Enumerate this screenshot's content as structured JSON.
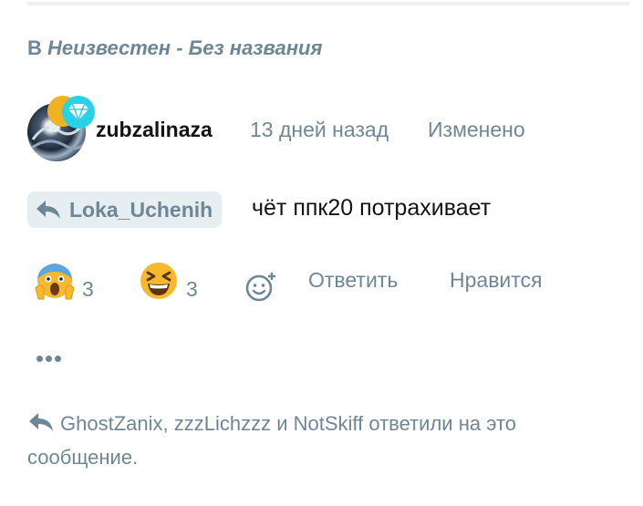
{
  "context": {
    "prefix": "В",
    "thread": "Неизвестен - Без названия"
  },
  "post": {
    "username": "zubzalinaza",
    "time": "13 дней назад",
    "edited": "Изменено",
    "reply_to": "Loka_Uchenih",
    "text": "чёт ппк20 потрахивает"
  },
  "reactions": [
    {
      "icon": "scream-emoji-icon",
      "count": "3"
    },
    {
      "icon": "laughing-emoji-icon",
      "count": "3"
    }
  ],
  "actions": {
    "reply": "Ответить",
    "like": "Нравится"
  },
  "replies_text": "GhostZanix, zzzLichzzz и NotSkiff ответили на это сообщение.",
  "colors": {
    "muted": "#6e8797",
    "chip_bg": "#e7eef2",
    "emoji_yellow": "#f6b82c",
    "diamond": "#2ad1e6"
  }
}
